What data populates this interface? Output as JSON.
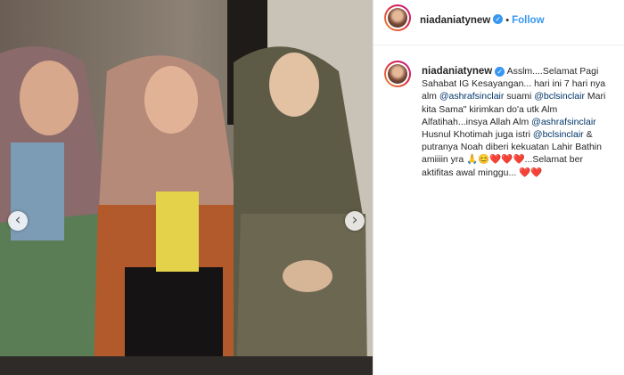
{
  "post": {
    "username": "niadaniatynew",
    "follow_label": "Follow",
    "separator": "•",
    "more_label": "...",
    "caption": {
      "part1": "Asslm....Selamat Pagi Sahabat IG Kesayangan... hari ini 7 hari nya alm",
      "mention1": "@ashrafsinclair",
      "part2": "suami",
      "mention2": "@bclsinclair",
      "part3": "Mari kita Sama\" kirimkan do'a utk Alm Alfatihah...insya Allah Alm",
      "mention3": "@ashrafsinclair",
      "part4": "Husnul Khotimah juga istri",
      "mention4": "@bclsinclair",
      "part5": "& putranya Noah diberi kekuatan Lahir Bathin amiiiin yra",
      "emoji1": "🙏",
      "emoji2": "😊",
      "emoji_hearts1": "❤️❤️❤️",
      "part6": "...Selamat ber aktifitas awal minggu...",
      "emoji_hearts2": "❤️❤️"
    },
    "carousel": {
      "prev_icon": "‹",
      "next_icon": "›"
    }
  },
  "colors": {
    "link": "#3897f0",
    "mention": "#003569",
    "text": "#262626"
  },
  "icons": {
    "verified": "verified-badge-icon",
    "prev": "chevron-left-icon",
    "next": "chevron-right-icon",
    "more": "more-options-icon"
  }
}
